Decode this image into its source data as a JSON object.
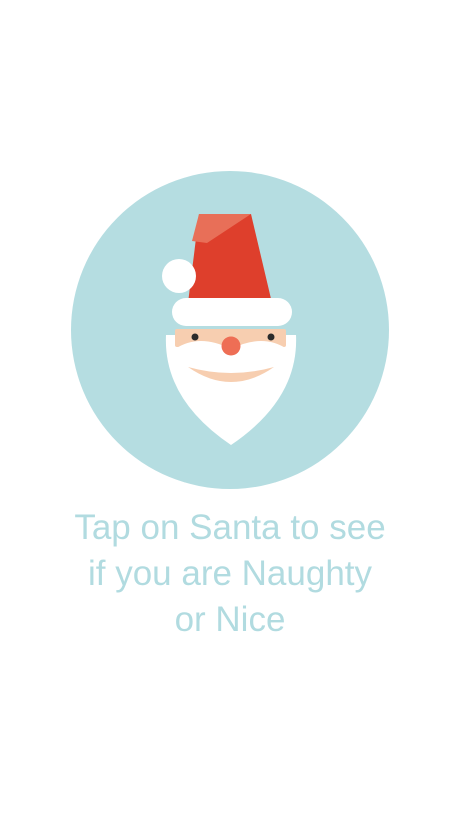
{
  "app": {
    "prompt_text": "Tap on Santa to see\nif you are Naughty\nor Nice"
  },
  "santa_button": {
    "icon": "santa-face-icon",
    "background_color": "#b5dde1"
  },
  "colors": {
    "hat_red": "#de3f2c",
    "hat_shade": "#e86f58",
    "skin": "#f7ceb0",
    "nose": "#ee6e55",
    "beard": "#ffffff",
    "text": "#b1dbe0"
  }
}
